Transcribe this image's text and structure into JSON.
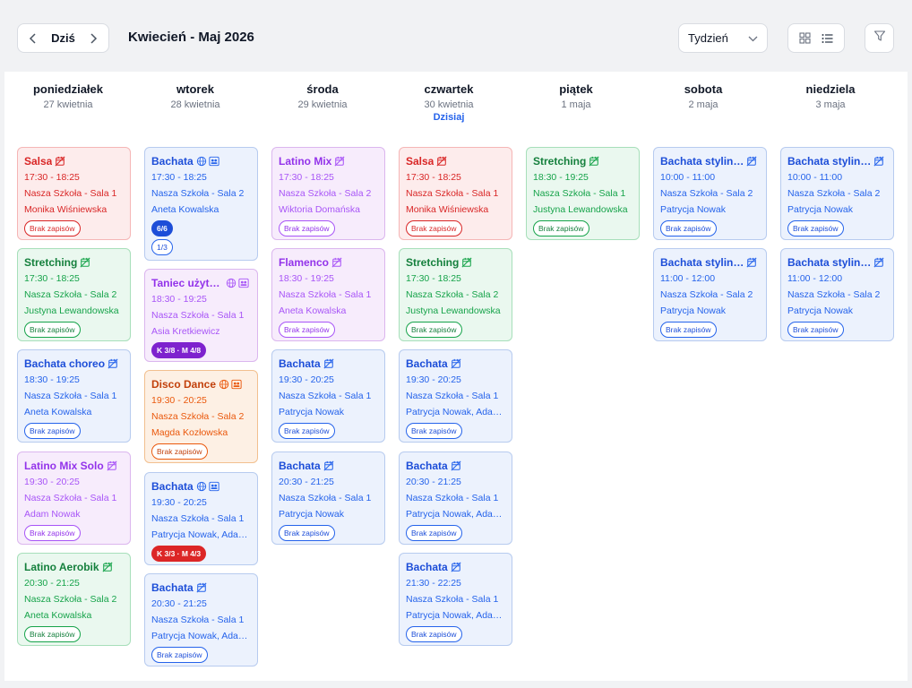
{
  "toolbar": {
    "today_label": "Dziś",
    "range_title": "Kwiecień - Maj 2026",
    "view_select": "Tydzień"
  },
  "colors": {
    "red": "#d92626",
    "green": "#16a34a",
    "blue": "#2563eb",
    "purple": "#a855f7",
    "orange": "#ea580c",
    "pill_blue": "#1d4ed8",
    "pill_purple": "#7e22ce",
    "pill_red": "#dc2626"
  },
  "days": [
    {
      "name": "poniedziałek",
      "date": "27 kwietnia"
    },
    {
      "name": "wtorek",
      "date": "28 kwietnia"
    },
    {
      "name": "środa",
      "date": "29 kwietnia"
    },
    {
      "name": "czwartek",
      "date": "30 kwietnia",
      "today": "Dzisiaj"
    },
    {
      "name": "piątek",
      "date": "1 maja"
    },
    {
      "name": "sobota",
      "date": "2 maja"
    },
    {
      "name": "niedziela",
      "date": "3 maja"
    }
  ],
  "events": {
    "d0e0": {
      "title": "Salsa",
      "time": "17:30 - 18:25",
      "place": "Nasza Szkoła - Sala 1",
      "teacher": "Monika Wiśniewska",
      "badge": "Brak zapisów",
      "icon": "no-booking-icon"
    },
    "d0e1": {
      "title": "Stretching",
      "time": "17:30 - 18:25",
      "place": "Nasza Szkoła - Sala 2",
      "teacher": "Justyna Lewandowska",
      "badge": "Brak zapisów",
      "icon": "no-booking-icon"
    },
    "d0e2": {
      "title": "Bachata choreo",
      "time": "18:30 - 19:25",
      "place": "Nasza Szkoła - Sala 1",
      "teacher": "Aneta Kowalska",
      "badge": "Brak zapisów",
      "icon": "no-booking-icon"
    },
    "d0e3": {
      "title": "Latino Mix Solo",
      "time": "19:30 - 20:25",
      "place": "Nasza Szkoła - Sala 1",
      "teacher": "Adam Nowak",
      "badge": "Brak zapisów",
      "icon": "no-booking-icon"
    },
    "d0e4": {
      "title": "Latino Aerobik",
      "time": "20:30 - 21:25",
      "place": "Nasza Szkoła - Sala 2",
      "teacher": "Aneta Kowalska",
      "badge": "Brak zapisów",
      "icon": "no-booking-icon"
    },
    "d1e0": {
      "title": "Bachata",
      "time": "17:30 - 18:25",
      "place": "Nasza Szkoła - Sala 2",
      "teacher": "Aneta Kowalska",
      "pill": "6/6",
      "pill2": "1/3",
      "icon": "globe-icon",
      "icon2": "pairs-icon"
    },
    "d1e1": {
      "title": "Taniec użytk…",
      "time": "18:30 - 19:25",
      "place": "Nasza Szkoła - Sala 1",
      "teacher": "Asia Kretkiewicz",
      "pill": "K 3/8 · M 4/8",
      "icon": "globe-icon",
      "icon2": "pairs-icon"
    },
    "d1e2": {
      "title": "Disco Dance",
      "time": "19:30 - 20:25",
      "place": "Nasza Szkoła - Sala 2",
      "teacher": "Magda Kozłowska",
      "badge": "Brak zapisów",
      "icon": "globe-icon",
      "icon2": "pairs-icon"
    },
    "d1e3": {
      "title": "Bachata",
      "time": "19:30 - 20:25",
      "place": "Nasza Szkoła - Sala 1",
      "teacher": "Patrycja Nowak, Ada…",
      "pill": "K 3/3 · M 4/3",
      "icon": "globe-icon",
      "icon2": "pairs-icon"
    },
    "d1e4": {
      "title": "Bachata",
      "time": "20:30 - 21:25",
      "place": "Nasza Szkoła - Sala 1",
      "teacher": "Patrycja Nowak, Ada…",
      "badge": "Brak zapisów",
      "icon": "no-booking-icon"
    },
    "d2e0": {
      "title": "Latino Mix",
      "time": "17:30 - 18:25",
      "place": "Nasza Szkoła - Sala 2",
      "teacher": "Wiktoria Domańska",
      "badge": "Brak zapisów",
      "icon": "no-booking-icon"
    },
    "d2e1": {
      "title": "Flamenco",
      "time": "18:30 - 19:25",
      "place": "Nasza Szkoła - Sala 1",
      "teacher": "Aneta Kowalska",
      "badge": "Brak zapisów",
      "icon": "no-booking-icon"
    },
    "d2e2": {
      "title": "Bachata",
      "time": "19:30 - 20:25",
      "place": "Nasza Szkoła - Sala 1",
      "teacher": "Patrycja Nowak",
      "badge": "Brak zapisów",
      "icon": "no-booking-icon"
    },
    "d2e3": {
      "title": "Bachata",
      "time": "20:30 - 21:25",
      "place": "Nasza Szkoła - Sala 1",
      "teacher": "Patrycja Nowak",
      "badge": "Brak zapisów",
      "icon": "no-booking-icon"
    },
    "d3e0": {
      "title": "Salsa",
      "time": "17:30 - 18:25",
      "place": "Nasza Szkoła - Sala 1",
      "teacher": "Monika Wiśniewska",
      "badge": "Brak zapisów",
      "icon": "no-booking-icon"
    },
    "d3e1": {
      "title": "Stretching",
      "time": "17:30 - 18:25",
      "place": "Nasza Szkoła - Sala 2",
      "teacher": "Justyna Lewandowska",
      "badge": "Brak zapisów",
      "icon": "no-booking-icon"
    },
    "d3e2": {
      "title": "Bachata",
      "time": "19:30 - 20:25",
      "place": "Nasza Szkoła - Sala 1",
      "teacher": "Patrycja Nowak, Ada…",
      "badge": "Brak zapisów",
      "icon": "no-booking-icon"
    },
    "d3e3": {
      "title": "Bachata",
      "time": "20:30 - 21:25",
      "place": "Nasza Szkoła - Sala 1",
      "teacher": "Patrycja Nowak, Ada…",
      "badge": "Brak zapisów",
      "icon": "no-booking-icon"
    },
    "d3e4": {
      "title": "Bachata",
      "time": "21:30 - 22:25",
      "place": "Nasza Szkoła - Sala 1",
      "teacher": "Patrycja Nowak, Ada…",
      "badge": "Brak zapisów",
      "icon": "no-booking-icon"
    },
    "d4e0": {
      "title": "Stretching",
      "time": "18:30 - 19:25",
      "place": "Nasza Szkoła - Sala 1",
      "teacher": "Justyna Lewandowska",
      "badge": "Brak zapisów",
      "icon": "no-booking-icon"
    },
    "d5e0": {
      "title": "Bachata stylin…",
      "time": "10:00 - 11:00",
      "place": "Nasza Szkoła - Sala 2",
      "teacher": "Patrycja Nowak",
      "badge": "Brak zapisów",
      "icon": "no-booking-icon"
    },
    "d5e1": {
      "title": "Bachata stylin…",
      "time": "11:00 - 12:00",
      "place": "Nasza Szkoła - Sala 2",
      "teacher": "Patrycja Nowak",
      "badge": "Brak zapisów",
      "icon": "no-booking-icon"
    },
    "d6e0": {
      "title": "Bachata stylin…",
      "time": "10:00 - 11:00",
      "place": "Nasza Szkoła - Sala 2",
      "teacher": "Patrycja Nowak",
      "badge": "Brak zapisów",
      "icon": "no-booking-icon"
    },
    "d6e1": {
      "title": "Bachata stylin…",
      "time": "11:00 - 12:00",
      "place": "Nasza Szkoła - Sala 2",
      "teacher": "Patrycja Nowak",
      "badge": "Brak zapisów",
      "icon": "no-booking-icon"
    }
  }
}
